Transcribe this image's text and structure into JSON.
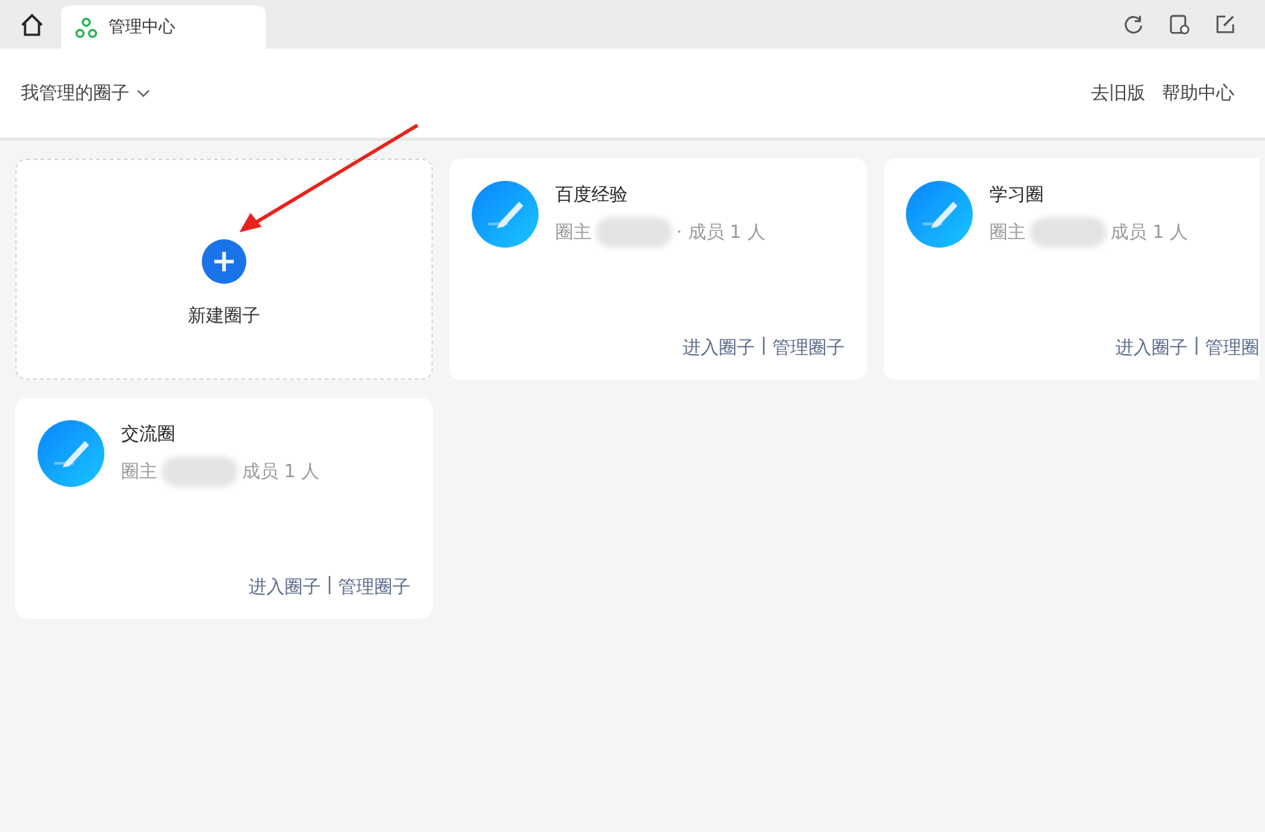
{
  "tabs": [
    {
      "label": "管理中心",
      "selected": true
    }
  ],
  "header": {
    "dropdown": "我管理的圈子",
    "links": [
      "去旧版",
      "帮助中心"
    ]
  },
  "new_circle": {
    "label": "新建圈子"
  },
  "circles": [
    {
      "name": "百度经验",
      "owner_label": "圈主",
      "members": "· 成员 1 人",
      "actions": [
        "进入圈子",
        "|",
        "管理圈子"
      ]
    },
    {
      "name": "学习圈",
      "owner_label": "圈主",
      "members": "成员 1 人",
      "actions": [
        "进入圈子",
        "|",
        "管理圈"
      ]
    },
    {
      "name": "交流圈",
      "owner_label": "圈主",
      "members": "成员 1 人",
      "actions": [
        "进入圈子",
        "|",
        "管理圈子"
      ]
    }
  ]
}
